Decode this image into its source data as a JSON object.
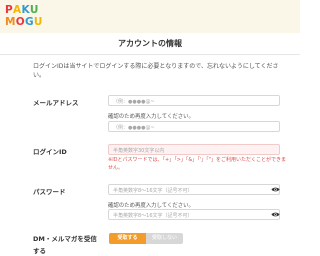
{
  "logo": {
    "row1": [
      {
        "ch": "P",
        "color": "#e8383d"
      },
      {
        "ch": "A",
        "color": "#f2b705"
      },
      {
        "ch": "K",
        "color": "#2e9bd6"
      },
      {
        "ch": "U",
        "color": "#4cb050"
      }
    ],
    "row2": [
      {
        "ch": "M",
        "color": "#f08c1e"
      },
      {
        "ch": "O",
        "color": "#e8383d"
      },
      {
        "ch": "G",
        "color": "#2e9bd6"
      },
      {
        "ch": "U",
        "color": "#f2b705"
      }
    ]
  },
  "page": {
    "title": "アカウントの情報",
    "intro": "ログインIDは当サイトでログインする際に必要となりますので、忘れないようにしてください。"
  },
  "email": {
    "label": "メールアドレス",
    "placeholder": "（例：●●●●@~",
    "confirm_note": "確認のため再度入力してください。",
    "confirm_placeholder": "（例：●●●●@~"
  },
  "login_id": {
    "label": "ログインID",
    "placeholder": "半角英数字30文字以内",
    "error": "※IDとパスワードでは、「+」「>」「&」「'」「\"」をご利用いただくことができません。"
  },
  "password": {
    "label": "パスワード",
    "placeholder": "半角英数字8～16文字（記号不可）",
    "confirm_note": "確認のため再度入力してください。",
    "confirm_placeholder": "半角英数字8～16文字（記号不可）"
  },
  "newsletter": {
    "label_line1": "DM・メルマガを受信",
    "label_line2": "する",
    "yes_label": "受取する",
    "no_label": "受取しない"
  },
  "colors": {
    "accent": "#f39c2a",
    "error": "#e04b4b",
    "header_bg": "#faf6e8"
  },
  "icons": [
    "eye-icon"
  ]
}
